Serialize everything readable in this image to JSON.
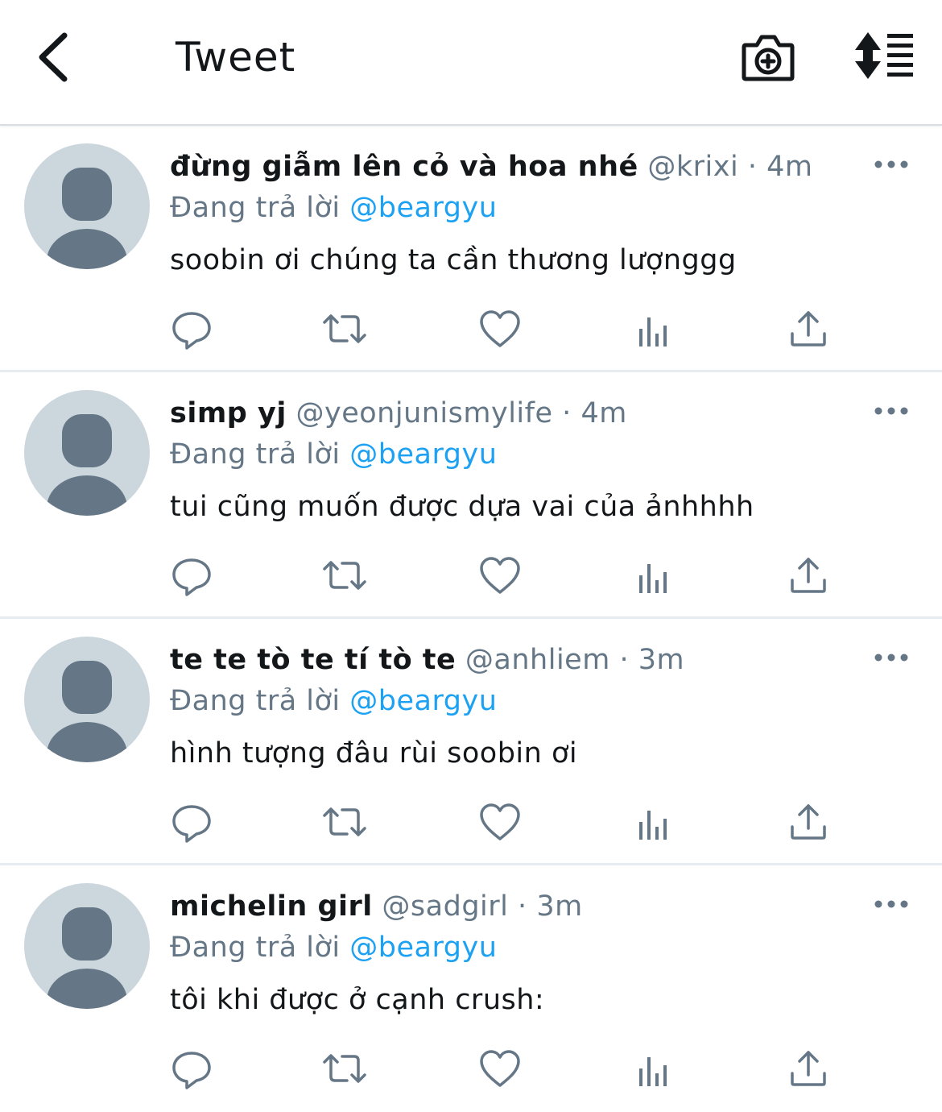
{
  "header": {
    "title": "Tweet",
    "back_icon": "chevron-left-icon",
    "camera_icon": "camera-plus-icon",
    "sort_icon": "sort-list-icon"
  },
  "colors": {
    "link": "#1da1f2",
    "secondary_text": "#657786",
    "primary_text": "#14171a",
    "avatar_bg": "#ccd6dd",
    "avatar_fg": "#657786",
    "divider": "#e6ecf0"
  },
  "tweets": [
    {
      "name": "đừng giẫm lên cỏ và hoa nhé",
      "handle": "@krixi",
      "dot": "·",
      "time": "4m",
      "replying_label": "Đang trả lời",
      "replying_to": "@beargyu",
      "text": "soobin ơi chúng ta cần thương lượnggg"
    },
    {
      "name": "simp yj",
      "handle": "@yeonjunismylife",
      "dot": "·",
      "time": "4m",
      "replying_label": "Đang trả lời",
      "replying_to": "@beargyu",
      "text": "tui cũng muốn được dựa vai của ảnhhhh"
    },
    {
      "name": "te te tò te tí tò te",
      "handle": "@anhliem",
      "dot": "·",
      "time": "3m",
      "replying_label": "Đang trả lời",
      "replying_to": "@beargyu",
      "text": "hình tượng đâu rùi soobin ơi"
    },
    {
      "name": "michelin girl",
      "handle": "@sadgirl",
      "dot": "·",
      "time": "3m",
      "replying_label": "Đang trả lời",
      "replying_to": "@beargyu",
      "text": "tôi khi được ở cạnh crush:"
    }
  ],
  "action_icons": [
    "reply-icon",
    "retweet-icon",
    "like-icon",
    "analytics-icon",
    "share-icon"
  ]
}
